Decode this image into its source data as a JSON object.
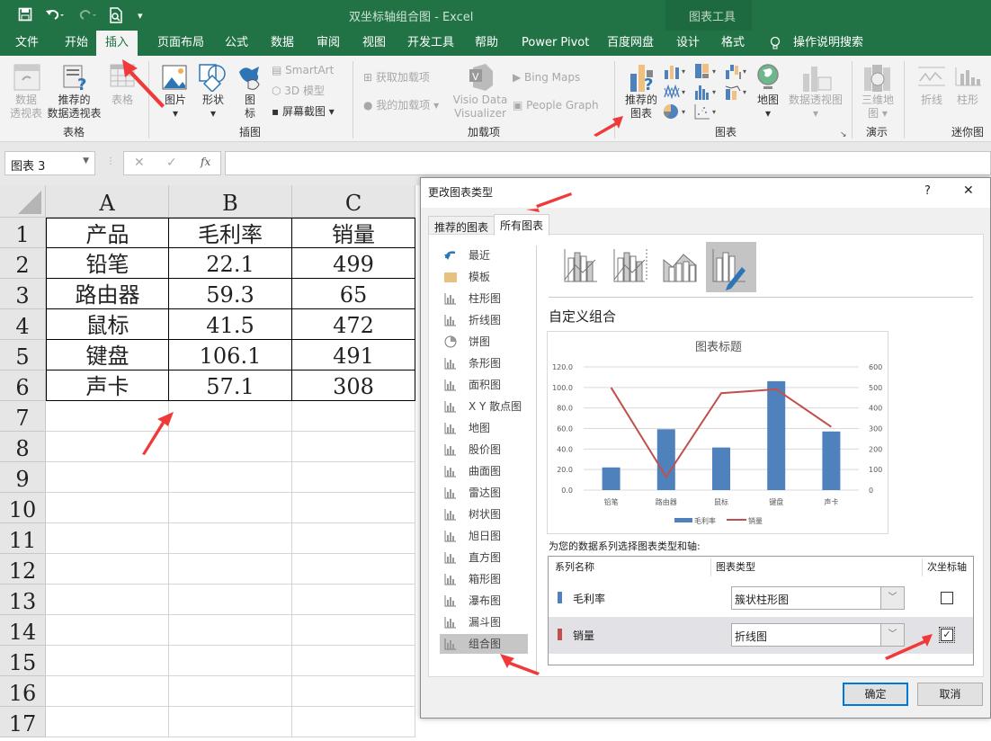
{
  "window": {
    "title": "双坐标轴组合图  -  Excel",
    "context_group": "图表工具"
  },
  "qat": {
    "save": "save-icon",
    "undo": "undo-icon",
    "redo": "redo-icon",
    "preview": "print-preview-icon",
    "customize": "▾"
  },
  "tabs": [
    {
      "label": "文件"
    },
    {
      "label": "开始"
    },
    {
      "label": "插入",
      "active": true
    },
    {
      "label": "页面布局"
    },
    {
      "label": "公式"
    },
    {
      "label": "数据"
    },
    {
      "label": "审阅"
    },
    {
      "label": "视图"
    },
    {
      "label": "开发工具"
    },
    {
      "label": "帮助"
    },
    {
      "label": "Power Pivot"
    },
    {
      "label": "百度网盘"
    },
    {
      "label": "设计"
    },
    {
      "label": "格式"
    }
  ],
  "tell_me": "操作说明搜索",
  "ribbon": {
    "groups": {
      "tables": "表格",
      "illustrations": "插图",
      "addins": "加载项",
      "charts": "图表",
      "tours": "演示",
      "sparklines": "迷你图"
    },
    "pivot_table": "数据\n透视表",
    "recommended_pivot": "推荐的\n数据透视表",
    "table": "表格",
    "pictures": "图片",
    "shapes": "形状",
    "icons": "图\n标",
    "smartart": "SmartArt",
    "model3d": "3D 模型",
    "screenshot": "屏幕截图",
    "get_addins": "获取加载项",
    "my_addins": "我的加载项",
    "visio": "Visio Data\nVisualizer",
    "bing_maps": "Bing Maps",
    "people_graph": "People Graph",
    "recommended_charts": "推荐的\n图表",
    "maps": "地图",
    "pivot_chart": "数据透视图",
    "map3d": "三维地\n图",
    "spark_line": "折线",
    "spark_column": "柱形"
  },
  "formula_bar": {
    "name_box": "图表 3",
    "cancel": "✕",
    "enter": "✓",
    "fx": "fx",
    "value": ""
  },
  "sheet": {
    "columns": [
      "A",
      "B",
      "C"
    ],
    "rows": [
      "1",
      "2",
      "3",
      "4",
      "5",
      "6",
      "7",
      "8",
      "9",
      "10",
      "11",
      "12",
      "13",
      "14",
      "15",
      "16",
      "17"
    ],
    "data": [
      [
        "产品",
        "毛利率",
        "销量"
      ],
      [
        "铅笔",
        "22.1",
        "499"
      ],
      [
        "路由器",
        "59.3",
        "65"
      ],
      [
        "鼠标",
        "41.5",
        "472"
      ],
      [
        "键盘",
        "106.1",
        "491"
      ],
      [
        "声卡",
        "57.1",
        "308"
      ]
    ]
  },
  "dialog": {
    "title": "更改图表类型",
    "help": "?",
    "close": "✕",
    "tabs": [
      {
        "label": "推荐的图表"
      },
      {
        "label": "所有图表",
        "active": true
      }
    ],
    "chart_types": [
      {
        "label": "最近",
        "icon": "recent-icon"
      },
      {
        "label": "模板",
        "icon": "folder-icon"
      },
      {
        "label": "柱形图",
        "icon": "column-chart-icon"
      },
      {
        "label": "折线图",
        "icon": "line-chart-icon"
      },
      {
        "label": "饼图",
        "icon": "pie-chart-icon"
      },
      {
        "label": "条形图",
        "icon": "bar-chart-icon"
      },
      {
        "label": "面积图",
        "icon": "area-chart-icon"
      },
      {
        "label": "X Y 散点图",
        "icon": "scatter-chart-icon"
      },
      {
        "label": "地图",
        "icon": "map-chart-icon"
      },
      {
        "label": "股价图",
        "icon": "stock-chart-icon"
      },
      {
        "label": "曲面图",
        "icon": "surface-chart-icon"
      },
      {
        "label": "雷达图",
        "icon": "radar-chart-icon"
      },
      {
        "label": "树状图",
        "icon": "treemap-chart-icon"
      },
      {
        "label": "旭日图",
        "icon": "sunburst-chart-icon"
      },
      {
        "label": "直方图",
        "icon": "histogram-chart-icon"
      },
      {
        "label": "箱形图",
        "icon": "box-chart-icon"
      },
      {
        "label": "瀑布图",
        "icon": "waterfall-chart-icon"
      },
      {
        "label": "漏斗图",
        "icon": "funnel-chart-icon"
      },
      {
        "label": "组合图",
        "icon": "combo-chart-icon",
        "selected": true
      }
    ],
    "subtypes": [
      "clustered-column-line",
      "clustered-column-line-secondary",
      "stacked-area-clustered-column",
      "custom-combination"
    ],
    "selected_subtype": 3,
    "subtype_heading": "自定义组合",
    "series_prompt": "为您的数据系列选择图表类型和轴:",
    "series_table": {
      "headers": [
        "系列名称",
        "图表类型",
        "次坐标轴"
      ],
      "rows": [
        {
          "name": "毛利率",
          "color": "#4f81bd",
          "type": "簇状柱形图",
          "secondary": false
        },
        {
          "name": "销量",
          "color": "#c0504d",
          "type": "折线图",
          "secondary": true
        }
      ]
    },
    "ok": "确定",
    "cancel": "取消"
  },
  "chart_data": {
    "type": "bar",
    "title": "图表标题",
    "categories": [
      "铅笔",
      "路由器",
      "鼠标",
      "键盘",
      "声卡"
    ],
    "series": [
      {
        "name": "毛利率",
        "type": "bar",
        "axis": "primary",
        "color": "#4f81bd",
        "values": [
          22.1,
          59.3,
          41.5,
          106.1,
          57.1
        ]
      },
      {
        "name": "销量",
        "type": "line",
        "axis": "secondary",
        "color": "#c0504d",
        "values": [
          499,
          65,
          472,
          491,
          308
        ]
      }
    ],
    "ylim": [
      0,
      120
    ],
    "yticks": [
      "0.0",
      "20.0",
      "40.0",
      "60.0",
      "80.0",
      "100.0",
      "120.0"
    ],
    "y2lim": [
      0,
      600
    ],
    "y2ticks": [
      "0",
      "100",
      "200",
      "300",
      "400",
      "500",
      "600"
    ],
    "grid": true,
    "legend": "bottom"
  }
}
